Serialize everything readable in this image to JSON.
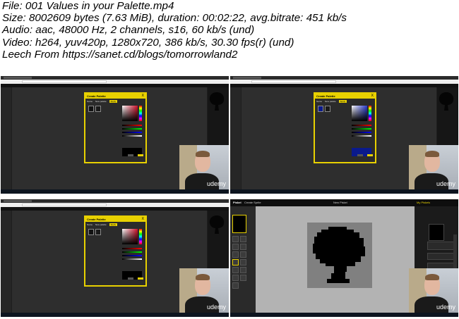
{
  "info": {
    "lines": [
      "File: 001 Values in your Palette.mp4",
      "Size: 8002609 bytes (7.63 MiB), duration: 00:02:22, avg.bitrate: 451 kb/s",
      "Audio: aac, 48000 Hz, 2 channels, s16, 60 kb/s (und)",
      "Video: h264, yuv420p, 1280x720, 386 kb/s, 30.30 fps(r) (und)",
      "Leech From https://sanet.cd/blogs/tomorrowland2"
    ]
  },
  "thumbnails": [
    {
      "dialog_title": "Create Palette",
      "close": "X",
      "tab_a": "Name",
      "tab_b": "New palette",
      "tab_c": "Apply",
      "selected_color": "#000000",
      "watermark": "udemy"
    },
    {
      "dialog_title": "Create Palette",
      "close": "X",
      "tab_a": "Name",
      "tab_b": "New palette",
      "tab_c": "Apply",
      "selected_color": "#0a1a8c",
      "watermark": "udemy"
    },
    {
      "dialog_title": "Create Palette",
      "close": "X",
      "tab_a": "Name",
      "tab_b": "New palette",
      "tab_c": "Apply",
      "selected_color": "#000000",
      "watermark": "udemy"
    },
    {
      "app_title": "Piskel",
      "create_sprite": "Create Sprite",
      "doc_title": "New Piskel",
      "my_piskels": "My Piskels",
      "watermark": "udemy"
    }
  ],
  "colors": {
    "accent_yellow": "#e8d100",
    "app_dark": "#1e1e1e",
    "canvas_gray": "#b3b3b3"
  }
}
